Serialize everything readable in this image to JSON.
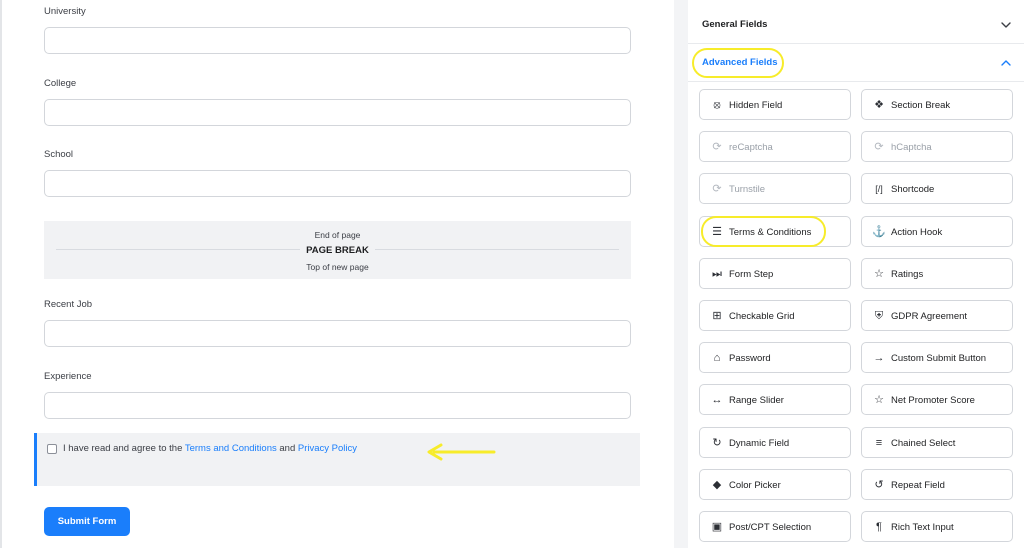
{
  "form": {
    "fields": [
      {
        "label": "University",
        "value": ""
      },
      {
        "label": "College",
        "value": ""
      },
      {
        "label": "School",
        "value": ""
      },
      {
        "label": "Recent Job",
        "value": ""
      },
      {
        "label": "Experience",
        "value": ""
      }
    ],
    "page_break": {
      "top_text": "End of page",
      "title": "PAGE BREAK",
      "bottom_text": "Top of new page"
    },
    "terms": {
      "prefix": "I have read and agree to the",
      "terms_link": "Terms and Conditions",
      "connector": "and",
      "privacy_link": "Privacy Policy",
      "checked": false
    },
    "submit_label": "Submit Form"
  },
  "sidebar": {
    "general_title": "General Fields",
    "advanced_title": "Advanced Fields",
    "advanced_fields": [
      {
        "label": "Hidden Field",
        "icon": "eye-slash-icon",
        "glyph": "⦻",
        "disabled": false
      },
      {
        "label": "Section Break",
        "icon": "puzzle-icon",
        "glyph": "❖",
        "disabled": false
      },
      {
        "label": "reCaptcha",
        "icon": "captcha-icon",
        "glyph": "⟳",
        "disabled": true
      },
      {
        "label": "hCaptcha",
        "icon": "captcha-icon",
        "glyph": "⟳",
        "disabled": true
      },
      {
        "label": "Turnstile",
        "icon": "captcha-icon",
        "glyph": "⟳",
        "disabled": true
      },
      {
        "label": "Shortcode",
        "icon": "shortcode-icon",
        "glyph": "[/]",
        "disabled": false
      },
      {
        "label": "Terms & Conditions",
        "icon": "document-icon",
        "glyph": "☰",
        "disabled": false
      },
      {
        "label": "Action Hook",
        "icon": "hook-icon",
        "glyph": "⚓",
        "disabled": false
      },
      {
        "label": "Form Step",
        "icon": "fast-forward-icon",
        "glyph": "⏭",
        "disabled": false
      },
      {
        "label": "Ratings",
        "icon": "star-icon",
        "glyph": "☆",
        "disabled": false
      },
      {
        "label": "Checkable Grid",
        "icon": "grid-icon",
        "glyph": "⊞",
        "disabled": false
      },
      {
        "label": "GDPR Agreement",
        "icon": "shield-icon",
        "glyph": "⛨",
        "disabled": false
      },
      {
        "label": "Password",
        "icon": "lock-icon",
        "glyph": "⌂",
        "disabled": false
      },
      {
        "label": "Custom Submit Button",
        "icon": "arrow-right-icon",
        "glyph": "→",
        "disabled": false
      },
      {
        "label": "Range Slider",
        "icon": "range-icon",
        "glyph": "↔",
        "disabled": false
      },
      {
        "label": "Net Promoter Score",
        "icon": "star-icon",
        "glyph": "☆",
        "disabled": false
      },
      {
        "label": "Dynamic Field",
        "icon": "refresh-icon",
        "glyph": "↻",
        "disabled": false
      },
      {
        "label": "Chained Select",
        "icon": "chain-icon",
        "glyph": "≡",
        "disabled": false
      },
      {
        "label": "Color Picker",
        "icon": "drop-icon",
        "glyph": "◆",
        "disabled": false
      },
      {
        "label": "Repeat Field",
        "icon": "repeat-icon",
        "glyph": "↺",
        "disabled": false
      },
      {
        "label": "Post/CPT Selection",
        "icon": "post-icon",
        "glyph": "▣",
        "disabled": false
      },
      {
        "label": "Rich Text Input",
        "icon": "paragraph-icon",
        "glyph": "¶",
        "disabled": false
      }
    ]
  },
  "colors": {
    "accent": "#1a7efb",
    "highlight": "#f7ec2a"
  }
}
